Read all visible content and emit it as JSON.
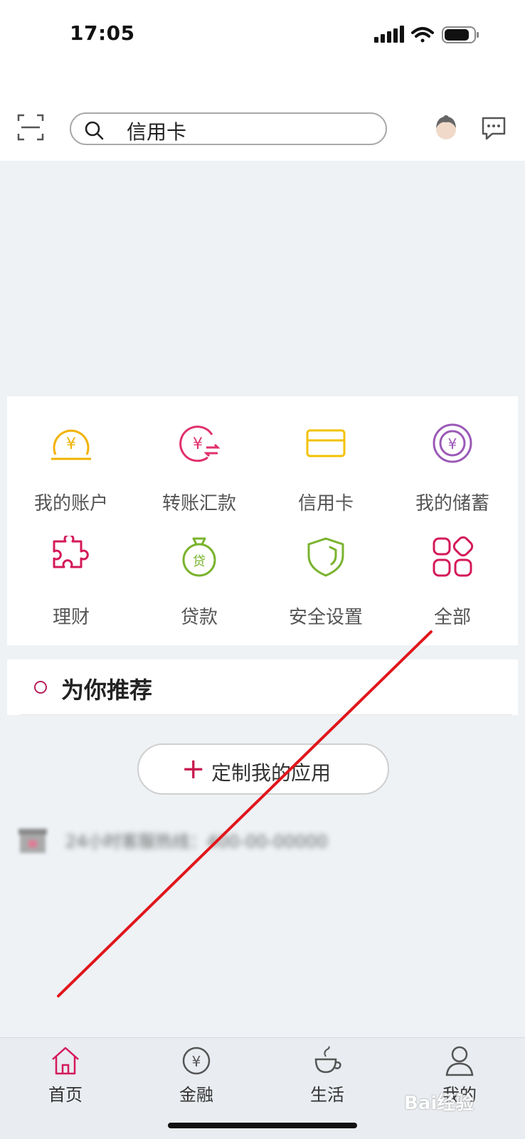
{
  "status_bar": {
    "time": "17:05"
  },
  "header": {
    "search_value": "信用卡"
  },
  "menu": {
    "items": [
      {
        "label": "我的账户",
        "icon": "account-yen-icon",
        "color": "#f2b200"
      },
      {
        "label": "转账汇款",
        "icon": "transfer-icon",
        "color": "#e0306b"
      },
      {
        "label": "信用卡",
        "icon": "credit-card-icon",
        "color": "#f2c200"
      },
      {
        "label": "我的储蓄",
        "icon": "savings-icon",
        "color": "#9b59b6"
      },
      {
        "label": "理财",
        "icon": "puzzle-icon",
        "color": "#d4195a"
      },
      {
        "label": "贷款",
        "icon": "loan-bag-icon",
        "color": "#7ab32e"
      },
      {
        "label": "安全设置",
        "icon": "shield-icon",
        "color": "#7ab32e"
      },
      {
        "label": "全部",
        "icon": "grid-icon",
        "color": "#d4195a"
      }
    ]
  },
  "recommend": {
    "title": "为你推荐"
  },
  "customize": {
    "label": "定制我的应用"
  },
  "hotline": {
    "text": "24小时客服热线：400-00-00000"
  },
  "tabs": [
    {
      "label": "首页",
      "icon": "home-icon",
      "active": true
    },
    {
      "label": "金融",
      "icon": "yen-circle-icon",
      "active": false
    },
    {
      "label": "生活",
      "icon": "cup-icon",
      "active": false
    },
    {
      "label": "我的",
      "icon": "person-icon",
      "active": false
    }
  ],
  "watermark": {
    "text": "Bai经验"
  },
  "colors": {
    "accent": "#d4195a",
    "annotation_line": "#e0161c"
  }
}
